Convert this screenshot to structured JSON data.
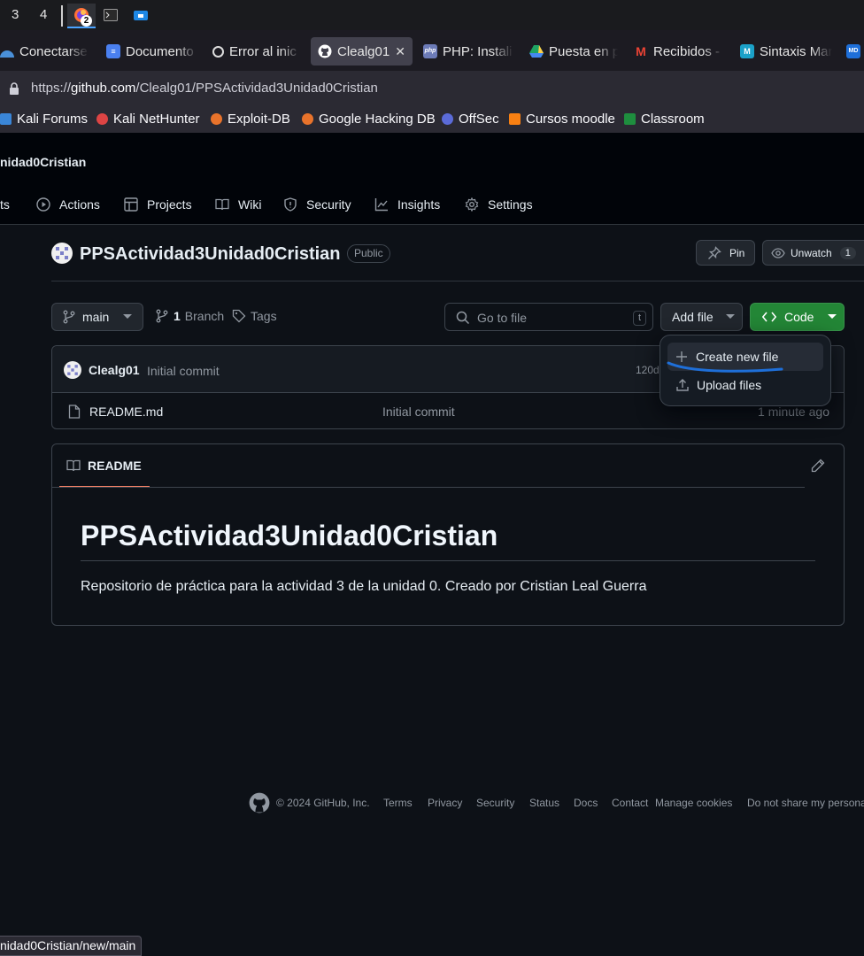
{
  "taskbar": {
    "workspaces": [
      "3",
      "4"
    ],
    "browser_badge": "2"
  },
  "tabs": [
    {
      "label": "Conectarse",
      "color": "#4a90d9",
      "glyph": ""
    },
    {
      "label": "Documento",
      "color": "#4a80f0",
      "glyph": "≡"
    },
    {
      "label": "Error al inic",
      "color": "#ffffff",
      "glyph": ""
    },
    {
      "label": "Clealg01/",
      "color": "#ffffff",
      "glyph": "",
      "active": true
    },
    {
      "label": "PHP: Instali",
      "color": "#6c7bb8",
      "glyph": "php"
    },
    {
      "label": "Puesta en p",
      "color": "#1fa463",
      "glyph": ""
    },
    {
      "label": "Recibidos -",
      "color": "#ea4335",
      "glyph": "M"
    },
    {
      "label": "Sintaxis Mar",
      "color": "#1ba1c8",
      "glyph": "M"
    }
  ],
  "urlbar": {
    "prefix": "https://",
    "host": "github.com",
    "path": "/Clealg01/PPSActividad3Unidad0Cristian"
  },
  "bookmarks": [
    {
      "label": "Kali Forums",
      "color": "#3a86d8"
    },
    {
      "label": "Kali NetHunter",
      "color": "#d44"
    },
    {
      "label": "Exploit-DB",
      "color": "#e8732b"
    },
    {
      "label": "Google Hacking DB",
      "color": "#e8732b"
    },
    {
      "label": "OffSec",
      "color": "#5b6bd8"
    },
    {
      "label": "Cursos moodle",
      "color": "#f98012"
    },
    {
      "label": "Classroom",
      "color": "#1e8e3e"
    }
  ],
  "header": {
    "repo_crumb": "nidad0Cristian",
    "nav": [
      {
        "label": "ts"
      },
      {
        "label": "Actions"
      },
      {
        "label": "Projects"
      },
      {
        "label": "Wiki"
      },
      {
        "label": "Security"
      },
      {
        "label": "Insights"
      },
      {
        "label": "Settings"
      }
    ]
  },
  "repo": {
    "name": "PPSActividad3Unidad0Cristian",
    "visibility": "Public",
    "pin_label": "Pin",
    "unwatch_label": "Unwatch",
    "watch_count": "1"
  },
  "filenav": {
    "branch": "main",
    "branch_count": "1",
    "branch_label": "Branch",
    "tags_label": "Tags",
    "search_placeholder": "Go to file",
    "search_key": "t",
    "add_file_label": "Add file",
    "code_label": "Code"
  },
  "commit": {
    "author": "Clealg01",
    "message": "Initial commit",
    "hash_partial": "120d"
  },
  "files": [
    {
      "name": "README.md",
      "message": "Initial commit",
      "time": "1 minute ago"
    }
  ],
  "dropdown": {
    "items": [
      "Create new file",
      "Upload files"
    ]
  },
  "readme": {
    "tab_label": "README",
    "title": "PPSActividad3Unidad0Cristian",
    "body": "Repositorio de práctica para la actividad 3 de la unidad 0. Creado por Cristian Leal Guerra"
  },
  "footer": {
    "copyright": "© 2024 GitHub, Inc.",
    "links": [
      "Terms",
      "Privacy",
      "Security",
      "Status",
      "Docs",
      "Contact",
      "Manage cookies",
      "Do not share my persona"
    ]
  },
  "statusbar": {
    "url": "nidad0Cristian/new/main"
  },
  "colors": {
    "accent_green": "#238636",
    "annotation_blue": "#1e6fd9",
    "readme_tab_underline": "#f78166"
  }
}
